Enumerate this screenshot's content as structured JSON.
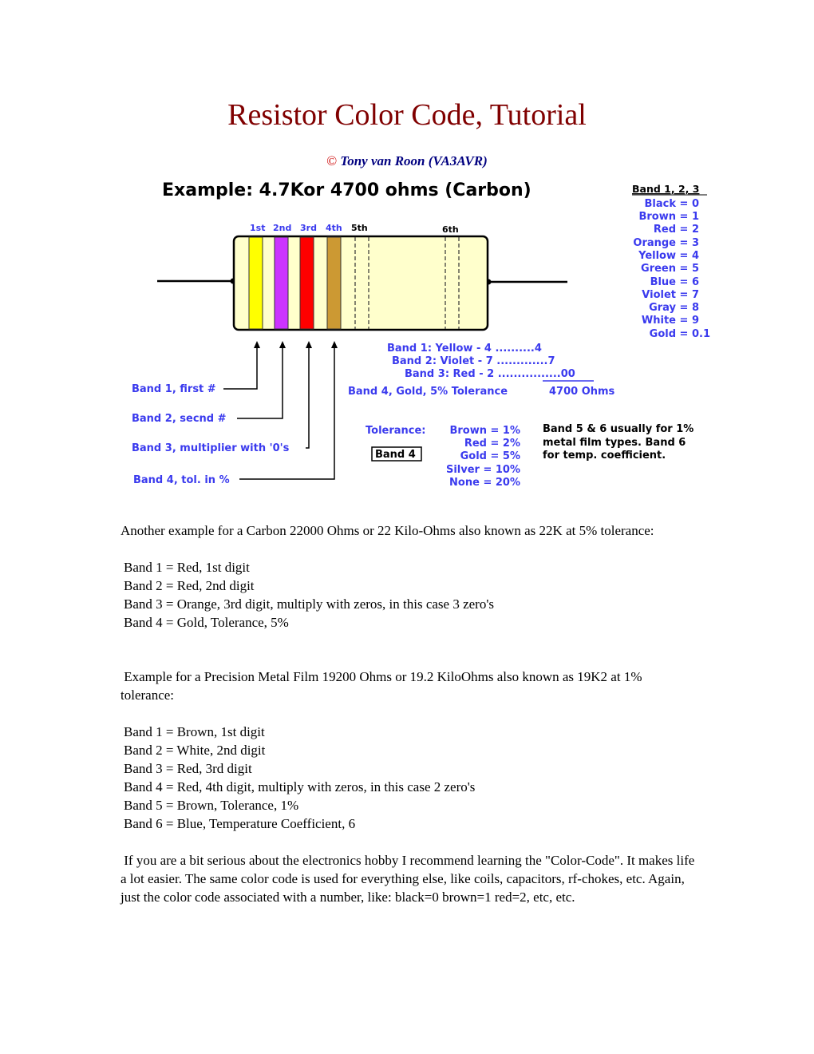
{
  "page": {
    "title": "Resistor Color Code, Tutorial",
    "copyright_symbol": "©",
    "author": "Tony van Roon (VA3AVR)"
  },
  "diagram": {
    "heading": "Example: 4.7Kor 4700 ohms (Carbon)",
    "band_position_labels": [
      "1st",
      "2nd",
      "3rd",
      "4th",
      "5th",
      "6th"
    ],
    "band_colors": [
      "#ffff00",
      "#cc33ff",
      "#ff0000",
      "#cc9933"
    ],
    "body_color": "#ffffcc",
    "color_table": {
      "heading": "Band 1, 2, 3",
      "rows": [
        "Black = 0",
        "Brown = 1",
        "Red = 2",
        "Orange = 3",
        "Yellow = 4",
        "Green = 5",
        "Blue = 6",
        "Violet = 7",
        "Gray = 8",
        "White = 9",
        "Gold = 0.1"
      ]
    },
    "calculation": {
      "lines": [
        "Band 1: Yellow - 4 ..........4",
        "Band 2: Violet - 7 .............7",
        "Band 3: Red - 2 ................00"
      ],
      "tolerance_line": "Band 4, Gold, 5% Tolerance",
      "result": "4700 Ohms"
    },
    "callouts": [
      "Band 1, first #",
      "Band 2, secnd #",
      "Band 3, multiplier with '0's",
      "Band 4, tol. in %"
    ],
    "tolerance_table": {
      "label": "Tolerance:",
      "box_label": "Band 4",
      "rows": [
        "Brown = 1%",
        "Red = 2%",
        "Gold = 5%",
        "Silver = 10%",
        "None = 20%"
      ]
    },
    "note_lines": [
      "Band 5 & 6 usually for 1%",
      "metal film types.  Band 6",
      "for temp. coefficient."
    ]
  },
  "example2": {
    "intro": "Another example for a Carbon 22000 Ohms or 22 Kilo-Ohms also known as 22K at 5% tolerance:",
    "bands": [
      "Band 1 = Red, 1st digit",
      "Band 2 = Red, 2nd digit",
      "Band 3 = Orange, 3rd digit, multiply with zeros, in this case 3 zero's",
      "Band 4 = Gold, Tolerance, 5%"
    ]
  },
  "example3": {
    "intro": "Example for a Precision Metal Film 19200 Ohms or 19.2 KiloOhms also known as 19K2 at 1% tolerance:",
    "bands": [
      "Band 1 = Brown, 1st digit",
      "Band 2 = White, 2nd digit",
      "Band 3 = Red, 3rd digit",
      "Band 4 = Red, 4th digit, multiply with zeros, in this case 2 zero's",
      "Band 5 = Brown, Tolerance, 1%",
      "Band 6 = Blue, Temperature Coefficient, 6"
    ]
  },
  "closing": "If you are a bit serious about the electronics hobby I recommend learning the \"Color-Code\". It makes life a lot easier. The same color code is used for everything else, like coils, capacitors, rf-chokes, etc. Again, just the color code associated with a number, like: black=0 brown=1 red=2, etc, etc."
}
